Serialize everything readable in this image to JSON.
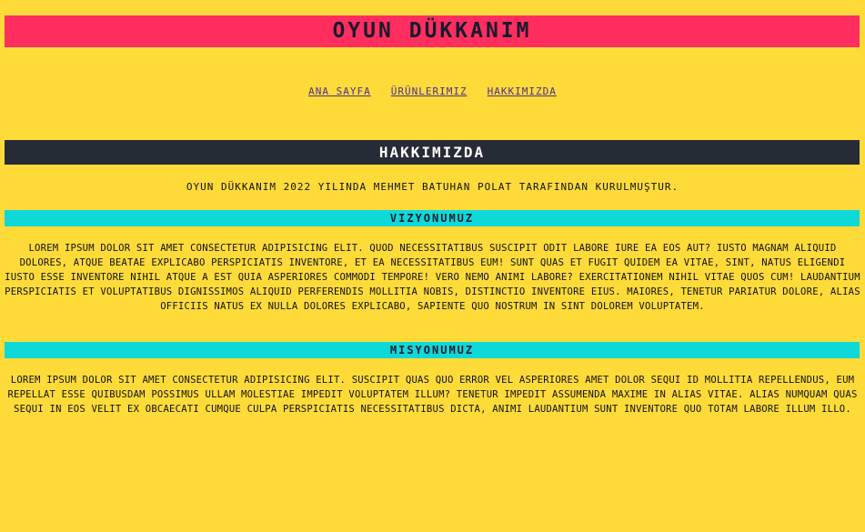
{
  "header": {
    "title": "OYUN DÜKKANIM"
  },
  "nav": {
    "items": [
      {
        "label": "ANA SAYFA"
      },
      {
        "label": "ÜRÜNLERIMIZ"
      },
      {
        "label": "HAKKIMIZDA"
      }
    ]
  },
  "about": {
    "title": "HAKKIMIZDA",
    "intro": "OYUN DÜKKANIM 2022 YILINDA MEHMET BATUHAN POLAT TARAFINDAN KURULMUŞTUR."
  },
  "vision": {
    "title": "VIZYONUMUZ",
    "text": "LOREM IPSUM DOLOR SIT AMET CONSECTETUR ADIPISICING ELIT. QUOD NECESSITATIBUS SUSCIPIT ODIT LABORE IURE EA EOS AUT? IUSTO MAGNAM ALIQUID DOLORES, ATQUE BEATAE EXPLICABO PERSPICIATIS INVENTORE, ET EA NECESSITATIBUS EUM! SUNT QUAS ET FUGIT QUIDEM EA VITAE, SINT, NATUS ELIGENDI IUSTO ESSE INVENTORE NIHIL ATQUE A EST QUIA ASPERIORES COMMODI TEMPORE! VERO NEMO ANIMI LABORE? EXERCITATIONEM NIHIL VITAE QUOS CUM! LAUDANTIUM PERSPICIATIS ET VOLUPTATIBUS DIGNISSIMOS ALIQUID PERFERENDIS MOLLITIA NOBIS, DISTINCTIO INVENTORE EIUS. MAIORES, TENETUR PARIATUR DOLORE, ALIAS OFFICIIS NATUS EX NULLA DOLORES EXPLICABO, SAPIENTE QUO NOSTRUM IN SINT DOLOREM VOLUPTATEM."
  },
  "mission": {
    "title": "MISYONUMUZ",
    "text": "LOREM IPSUM DOLOR SIT AMET CONSECTETUR ADIPISICING ELIT. SUSCIPIT QUAS QUO ERROR VEL ASPERIORES AMET DOLOR SEQUI ID MOLLITIA REPELLENDUS, EUM REPELLAT ESSE QUIBUSDAM POSSIMUS ULLAM MOLESTIAE IMPEDIT VOLUPTATEM ILLUM? TENETUR IMPEDIT ASSUMENDA MAXIME IN ALIAS VITAE. ALIAS NUMQUAM QUAS SEQUI IN EOS VELIT EX OBCAECATI CUMQUE CULPA PERSPICIATIS NECESSITATIBUS DICTA, ANIMI LAUDANTIUM SUNT INVENTORE QUO TOTAM LABORE ILLUM ILLO."
  },
  "colors": {
    "background": "#ffdb3a",
    "header": "#ff2e5f",
    "about_bar": "#272b35",
    "section_bar": "#0fd8d8",
    "link": "#4b2f8f"
  }
}
